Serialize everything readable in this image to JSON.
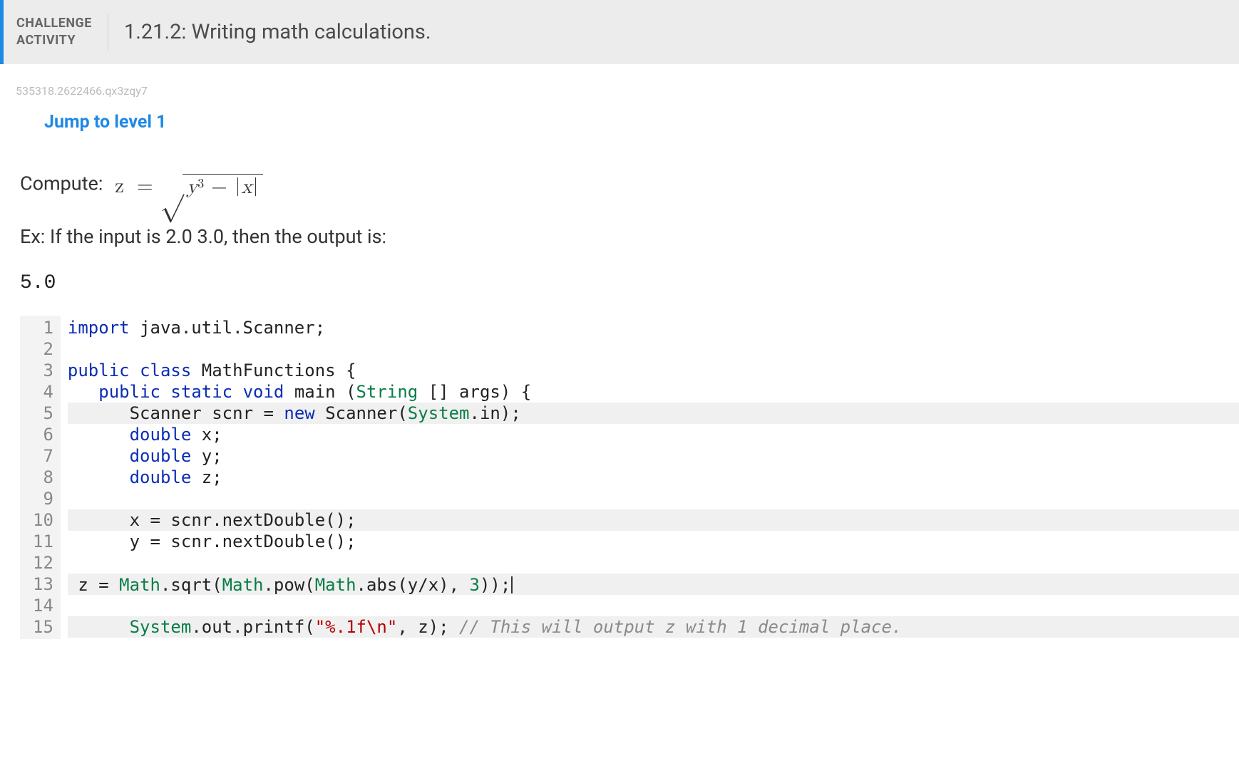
{
  "header": {
    "badge_line1": "CHALLENGE",
    "badge_line2": "ACTIVITY",
    "title": "1.21.2: Writing math calculations."
  },
  "meta_id": "535318.2622466.qx3zqy7",
  "jump_link": "Jump to level 1",
  "prompt_label": "Compute:",
  "formula": {
    "lhs": "z",
    "eq": "=",
    "y": "y",
    "y_exp": "3",
    "minus": "−",
    "x": "x"
  },
  "example_text": "Ex: If the input is 2.0 3.0, then the output is:",
  "example_output": "5.0",
  "code": {
    "lines": [
      {
        "n": "1",
        "hl": false,
        "tokens": [
          [
            "kw",
            "import"
          ],
          [
            "sp",
            " "
          ],
          [
            "pkg",
            "java.util.Scanner"
          ],
          [
            "op",
            ";"
          ]
        ]
      },
      {
        "n": "2",
        "hl": false,
        "tokens": []
      },
      {
        "n": "3",
        "hl": false,
        "tokens": [
          [
            "kw",
            "public"
          ],
          [
            "sp",
            " "
          ],
          [
            "kw",
            "class"
          ],
          [
            "sp",
            " "
          ],
          [
            "id",
            "MathFunctions"
          ],
          [
            "sp",
            " "
          ],
          [
            "op",
            "{"
          ]
        ]
      },
      {
        "n": "4",
        "hl": false,
        "tokens": [
          [
            "sp",
            "   "
          ],
          [
            "kw",
            "public"
          ],
          [
            "sp",
            " "
          ],
          [
            "kw",
            "static"
          ],
          [
            "sp",
            " "
          ],
          [
            "kw",
            "void"
          ],
          [
            "sp",
            " "
          ],
          [
            "id",
            "main"
          ],
          [
            "sp",
            " "
          ],
          [
            "op",
            "("
          ],
          [
            "type",
            "String"
          ],
          [
            "sp",
            " "
          ],
          [
            "op",
            "[]"
          ],
          [
            "sp",
            " "
          ],
          [
            "id",
            "args"
          ],
          [
            "op",
            ")"
          ],
          [
            "sp",
            " "
          ],
          [
            "op",
            "{"
          ]
        ]
      },
      {
        "n": "5",
        "hl": true,
        "tokens": [
          [
            "sp",
            "      "
          ],
          [
            "id",
            "Scanner"
          ],
          [
            "sp",
            " "
          ],
          [
            "id",
            "scnr"
          ],
          [
            "sp",
            " "
          ],
          [
            "op",
            "="
          ],
          [
            "sp",
            " "
          ],
          [
            "kw",
            "new"
          ],
          [
            "sp",
            " "
          ],
          [
            "id",
            "Scanner"
          ],
          [
            "op",
            "("
          ],
          [
            "type",
            "System"
          ],
          [
            "op",
            "."
          ],
          [
            "id",
            "in"
          ],
          [
            "op",
            ")"
          ],
          [
            "op",
            ";"
          ]
        ]
      },
      {
        "n": "6",
        "hl": false,
        "tokens": [
          [
            "sp",
            "      "
          ],
          [
            "kw",
            "double"
          ],
          [
            "sp",
            " "
          ],
          [
            "id",
            "x"
          ],
          [
            "op",
            ";"
          ]
        ]
      },
      {
        "n": "7",
        "hl": false,
        "tokens": [
          [
            "sp",
            "      "
          ],
          [
            "kw",
            "double"
          ],
          [
            "sp",
            " "
          ],
          [
            "id",
            "y"
          ],
          [
            "op",
            ";"
          ]
        ]
      },
      {
        "n": "8",
        "hl": false,
        "tokens": [
          [
            "sp",
            "      "
          ],
          [
            "kw",
            "double"
          ],
          [
            "sp",
            " "
          ],
          [
            "id",
            "z"
          ],
          [
            "op",
            ";"
          ]
        ]
      },
      {
        "n": "9",
        "hl": false,
        "tokens": []
      },
      {
        "n": "10",
        "hl": true,
        "tokens": [
          [
            "sp",
            "      "
          ],
          [
            "id",
            "x"
          ],
          [
            "sp",
            " "
          ],
          [
            "op",
            "="
          ],
          [
            "sp",
            " "
          ],
          [
            "id",
            "scnr"
          ],
          [
            "op",
            "."
          ],
          [
            "id",
            "nextDouble"
          ],
          [
            "op",
            "()"
          ],
          [
            "op",
            ";"
          ]
        ]
      },
      {
        "n": "11",
        "hl": false,
        "tokens": [
          [
            "sp",
            "      "
          ],
          [
            "id",
            "y"
          ],
          [
            "sp",
            " "
          ],
          [
            "op",
            "="
          ],
          [
            "sp",
            " "
          ],
          [
            "id",
            "scnr"
          ],
          [
            "op",
            "."
          ],
          [
            "id",
            "nextDouble"
          ],
          [
            "op",
            "()"
          ],
          [
            "op",
            ";"
          ]
        ]
      },
      {
        "n": "12",
        "hl": false,
        "tokens": []
      },
      {
        "n": "13",
        "hl": true,
        "tokens": [
          [
            "sp",
            " "
          ],
          [
            "id",
            "z"
          ],
          [
            "sp",
            " "
          ],
          [
            "op",
            "="
          ],
          [
            "sp",
            " "
          ],
          [
            "type",
            "Math"
          ],
          [
            "op",
            "."
          ],
          [
            "id",
            "sqrt"
          ],
          [
            "op",
            "("
          ],
          [
            "type",
            "Math"
          ],
          [
            "op",
            "."
          ],
          [
            "id",
            "pow"
          ],
          [
            "op",
            "("
          ],
          [
            "type",
            "Math"
          ],
          [
            "op",
            "."
          ],
          [
            "id",
            "abs"
          ],
          [
            "op",
            "("
          ],
          [
            "id",
            "y"
          ],
          [
            "op",
            "/"
          ],
          [
            "id",
            "x"
          ],
          [
            "op",
            ")"
          ],
          [
            "op",
            ","
          ],
          [
            "sp",
            " "
          ],
          [
            "num",
            "3"
          ],
          [
            "op",
            "))"
          ],
          [
            "op",
            ";"
          ],
          [
            "cursor",
            ""
          ]
        ]
      },
      {
        "n": "14",
        "hl": false,
        "tokens": []
      },
      {
        "n": "15",
        "hl": true,
        "tokens": [
          [
            "sp",
            "      "
          ],
          [
            "type",
            "System"
          ],
          [
            "op",
            "."
          ],
          [
            "id",
            "out"
          ],
          [
            "op",
            "."
          ],
          [
            "id",
            "printf"
          ],
          [
            "op",
            "("
          ],
          [
            "str",
            "\"%.1f\\n\""
          ],
          [
            "op",
            ","
          ],
          [
            "sp",
            " "
          ],
          [
            "id",
            "z"
          ],
          [
            "op",
            ")"
          ],
          [
            "op",
            ";"
          ],
          [
            "sp",
            " "
          ],
          [
            "cmt",
            "// This will output z with 1 decimal place."
          ]
        ]
      }
    ]
  }
}
